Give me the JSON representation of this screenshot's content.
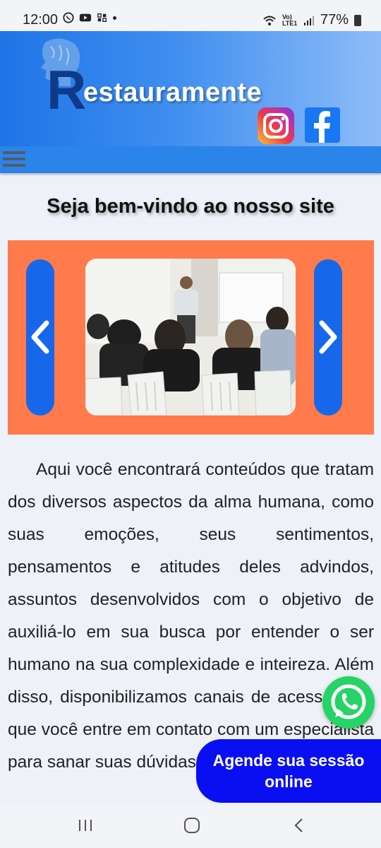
{
  "status_bar": {
    "time": "12:00",
    "signal_label": "Vo) LTE1",
    "battery": "77%"
  },
  "header": {
    "logo_letter": "R",
    "logo_text": "estauramente",
    "instagram_icon": "instagram-icon",
    "facebook_icon": "facebook-icon"
  },
  "nav": {
    "menu_icon": "hamburger-icon"
  },
  "welcome_title": "Seja bem-vindo ao nosso site",
  "carousel": {
    "prev_icon": "chevron-left-icon",
    "next_icon": "chevron-right-icon",
    "colors": {
      "background": "#ff7b4b",
      "arrows": "#1767ea"
    }
  },
  "intro_text": "Aqui você encontrará conteúdos que tratam dos diversos aspectos da alma humana, como suas emoções, seus sentimentos, pensamentos e atitudes deles advindos, assuntos desenvolvidos com o objetivo de auxiliá-lo em sua busca por entender o ser humano na sua complexidade e inteireza. Além disso, disponibilizamos canais de acesso para que você entre em contato com um especialista para sanar suas dúvidas e",
  "whatsapp_icon": "whatsapp-icon",
  "schedule_button": "Agende sua sessão online",
  "system_nav": {
    "recents_icon": "recents-icon",
    "home_icon": "home-icon",
    "back_icon": "back-icon"
  }
}
